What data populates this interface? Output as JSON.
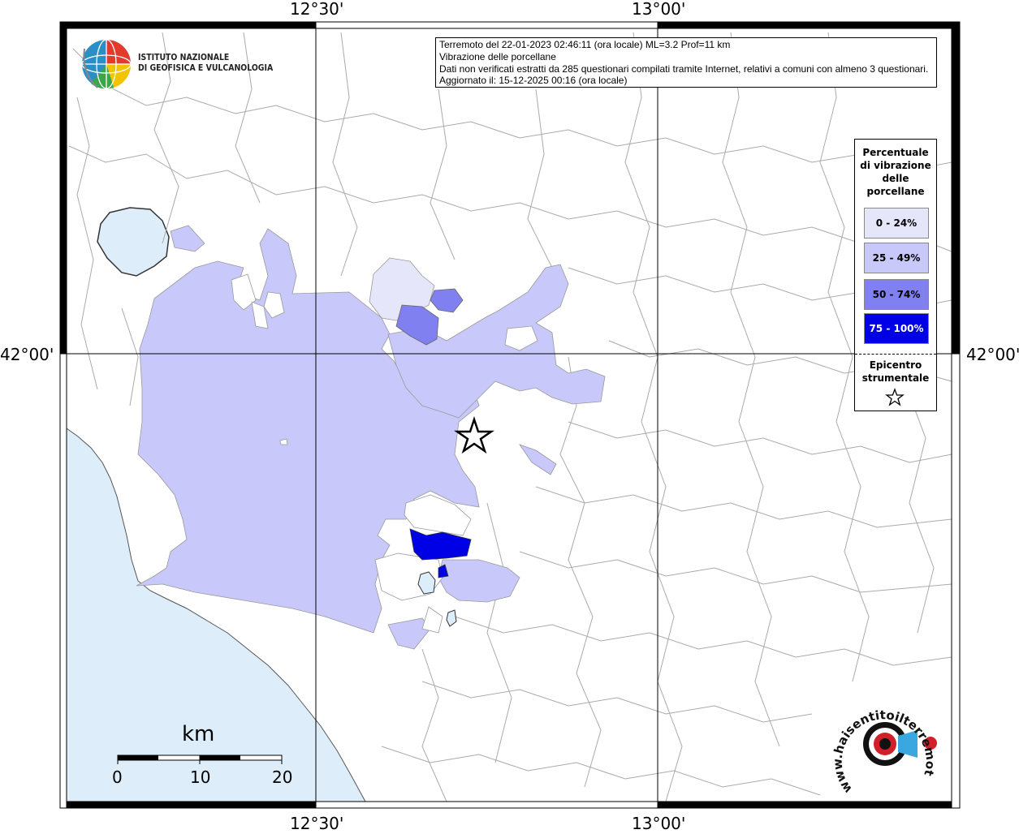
{
  "map": {
    "axis_labels": {
      "top_left": "12°30'",
      "top_right": "13°00'",
      "bottom_left": "12°30'",
      "bottom_right": "13°00'",
      "left": "42°00'",
      "right": "42°00'"
    },
    "colors": {
      "sea": "#ddeefa",
      "lake": "#ddeefa",
      "land": "#ffffff",
      "border_lines": "#aaaaaa",
      "grid": "#000000",
      "class_0_24": "#e6e6fa",
      "class_25_49": "#c8c8fa",
      "class_50_74": "#8080f0",
      "class_75_100": "#0000e6"
    }
  },
  "info": {
    "line1": "Terremoto del 22-01-2023 02:46:11 (ora locale) ML=3.2 Prof=11 km",
    "line2": "Vibrazione delle porcellane",
    "line3": "Dati non verificati estratti da 285 questionari compilati tramite Internet, relativi a comuni con almeno 3 questionari.",
    "line4": "Aggiornato il: 15-12-2025 00:16 (ora locale)"
  },
  "logo_ingv": {
    "line1": "ISTITUTO NAZIONALE",
    "line2": "DI GEOFISICA E VULCANOLOGIA"
  },
  "logo_hsit": {
    "text": "www.haisentitoilterremoto.it"
  },
  "legend": {
    "title_lines": [
      "Percentuale",
      "di vibrazione",
      "delle",
      "porcellane"
    ],
    "classes": [
      {
        "label": "0 - 24%",
        "color": "#e6e6fa",
        "text_color": "#000000"
      },
      {
        "label": "25 - 49%",
        "color": "#c8c8fa",
        "text_color": "#000000"
      },
      {
        "label": "50 - 74%",
        "color": "#8080f0",
        "text_color": "#000000"
      },
      {
        "label": "75 - 100%",
        "color": "#0000e6",
        "text_color": "#ffffff"
      }
    ],
    "epicenter_lines": [
      "Epicentro",
      "strumentale"
    ],
    "epicenter_icon": "star-outline-icon"
  },
  "scale_bar": {
    "unit": "km",
    "ticks": [
      "0",
      "10",
      "20"
    ]
  }
}
